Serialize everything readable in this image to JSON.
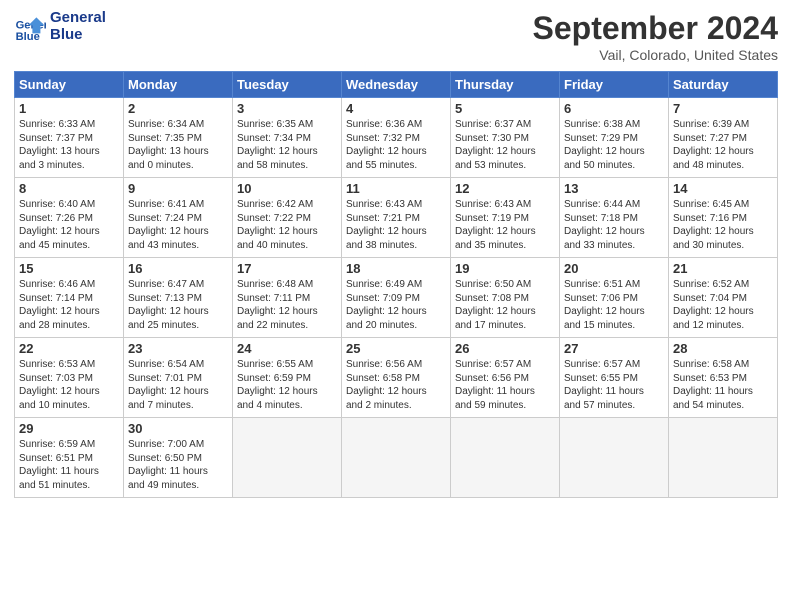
{
  "header": {
    "logo_line1": "General",
    "logo_line2": "Blue",
    "month": "September 2024",
    "location": "Vail, Colorado, United States"
  },
  "weekdays": [
    "Sunday",
    "Monday",
    "Tuesday",
    "Wednesday",
    "Thursday",
    "Friday",
    "Saturday"
  ],
  "weeks": [
    [
      {
        "day": "1",
        "info": "Sunrise: 6:33 AM\nSunset: 7:37 PM\nDaylight: 13 hours\nand 3 minutes."
      },
      {
        "day": "2",
        "info": "Sunrise: 6:34 AM\nSunset: 7:35 PM\nDaylight: 13 hours\nand 0 minutes."
      },
      {
        "day": "3",
        "info": "Sunrise: 6:35 AM\nSunset: 7:34 PM\nDaylight: 12 hours\nand 58 minutes."
      },
      {
        "day": "4",
        "info": "Sunrise: 6:36 AM\nSunset: 7:32 PM\nDaylight: 12 hours\nand 55 minutes."
      },
      {
        "day": "5",
        "info": "Sunrise: 6:37 AM\nSunset: 7:30 PM\nDaylight: 12 hours\nand 53 minutes."
      },
      {
        "day": "6",
        "info": "Sunrise: 6:38 AM\nSunset: 7:29 PM\nDaylight: 12 hours\nand 50 minutes."
      },
      {
        "day": "7",
        "info": "Sunrise: 6:39 AM\nSunset: 7:27 PM\nDaylight: 12 hours\nand 48 minutes."
      }
    ],
    [
      {
        "day": "8",
        "info": "Sunrise: 6:40 AM\nSunset: 7:26 PM\nDaylight: 12 hours\nand 45 minutes."
      },
      {
        "day": "9",
        "info": "Sunrise: 6:41 AM\nSunset: 7:24 PM\nDaylight: 12 hours\nand 43 minutes."
      },
      {
        "day": "10",
        "info": "Sunrise: 6:42 AM\nSunset: 7:22 PM\nDaylight: 12 hours\nand 40 minutes."
      },
      {
        "day": "11",
        "info": "Sunrise: 6:43 AM\nSunset: 7:21 PM\nDaylight: 12 hours\nand 38 minutes."
      },
      {
        "day": "12",
        "info": "Sunrise: 6:43 AM\nSunset: 7:19 PM\nDaylight: 12 hours\nand 35 minutes."
      },
      {
        "day": "13",
        "info": "Sunrise: 6:44 AM\nSunset: 7:18 PM\nDaylight: 12 hours\nand 33 minutes."
      },
      {
        "day": "14",
        "info": "Sunrise: 6:45 AM\nSunset: 7:16 PM\nDaylight: 12 hours\nand 30 minutes."
      }
    ],
    [
      {
        "day": "15",
        "info": "Sunrise: 6:46 AM\nSunset: 7:14 PM\nDaylight: 12 hours\nand 28 minutes."
      },
      {
        "day": "16",
        "info": "Sunrise: 6:47 AM\nSunset: 7:13 PM\nDaylight: 12 hours\nand 25 minutes."
      },
      {
        "day": "17",
        "info": "Sunrise: 6:48 AM\nSunset: 7:11 PM\nDaylight: 12 hours\nand 22 minutes."
      },
      {
        "day": "18",
        "info": "Sunrise: 6:49 AM\nSunset: 7:09 PM\nDaylight: 12 hours\nand 20 minutes."
      },
      {
        "day": "19",
        "info": "Sunrise: 6:50 AM\nSunset: 7:08 PM\nDaylight: 12 hours\nand 17 minutes."
      },
      {
        "day": "20",
        "info": "Sunrise: 6:51 AM\nSunset: 7:06 PM\nDaylight: 12 hours\nand 15 minutes."
      },
      {
        "day": "21",
        "info": "Sunrise: 6:52 AM\nSunset: 7:04 PM\nDaylight: 12 hours\nand 12 minutes."
      }
    ],
    [
      {
        "day": "22",
        "info": "Sunrise: 6:53 AM\nSunset: 7:03 PM\nDaylight: 12 hours\nand 10 minutes."
      },
      {
        "day": "23",
        "info": "Sunrise: 6:54 AM\nSunset: 7:01 PM\nDaylight: 12 hours\nand 7 minutes."
      },
      {
        "day": "24",
        "info": "Sunrise: 6:55 AM\nSunset: 6:59 PM\nDaylight: 12 hours\nand 4 minutes."
      },
      {
        "day": "25",
        "info": "Sunrise: 6:56 AM\nSunset: 6:58 PM\nDaylight: 12 hours\nand 2 minutes."
      },
      {
        "day": "26",
        "info": "Sunrise: 6:57 AM\nSunset: 6:56 PM\nDaylight: 11 hours\nand 59 minutes."
      },
      {
        "day": "27",
        "info": "Sunrise: 6:57 AM\nSunset: 6:55 PM\nDaylight: 11 hours\nand 57 minutes."
      },
      {
        "day": "28",
        "info": "Sunrise: 6:58 AM\nSunset: 6:53 PM\nDaylight: 11 hours\nand 54 minutes."
      }
    ],
    [
      {
        "day": "29",
        "info": "Sunrise: 6:59 AM\nSunset: 6:51 PM\nDaylight: 11 hours\nand 51 minutes."
      },
      {
        "day": "30",
        "info": "Sunrise: 7:00 AM\nSunset: 6:50 PM\nDaylight: 11 hours\nand 49 minutes."
      },
      {
        "day": "",
        "info": ""
      },
      {
        "day": "",
        "info": ""
      },
      {
        "day": "",
        "info": ""
      },
      {
        "day": "",
        "info": ""
      },
      {
        "day": "",
        "info": ""
      }
    ]
  ]
}
